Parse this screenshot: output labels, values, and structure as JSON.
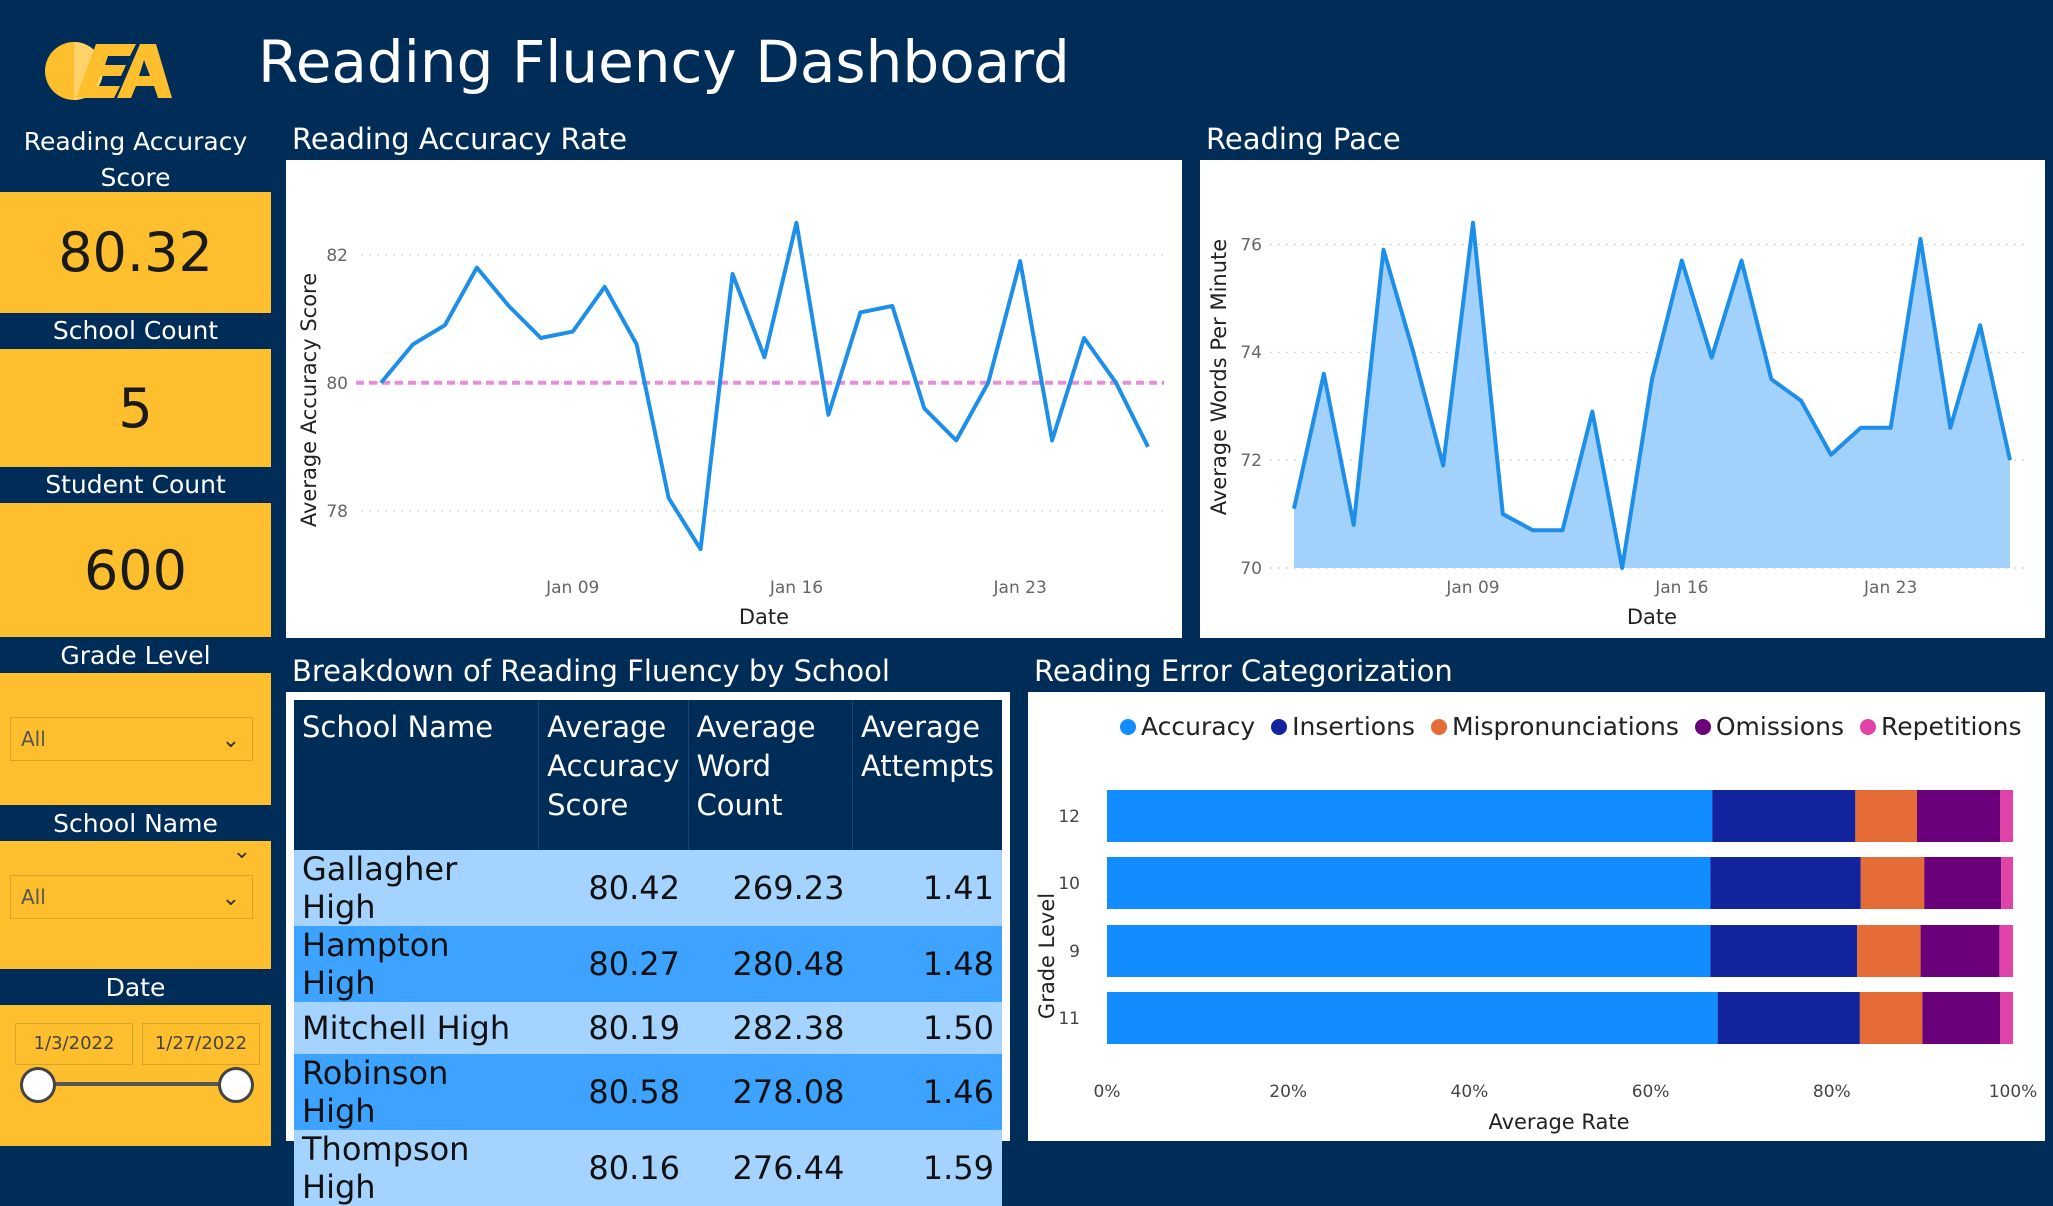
{
  "header": {
    "title": "Reading Fluency Dashboard",
    "logo_text": "OEA"
  },
  "sidebar": {
    "accuracy_label": "Reading Accuracy Score",
    "accuracy_value": "80.32",
    "school_count_label": "School Count",
    "school_count_value": "5",
    "student_count_label": "Student Count",
    "student_count_value": "600",
    "grade_level_label": "Grade Level",
    "grade_level_value": "All",
    "school_name_label": "School Name",
    "school_name_value": "All",
    "date_label": "Date",
    "date_start": "1/3/2022",
    "date_end": "1/27/2022"
  },
  "accuracy_chart": {
    "title": "Reading Accuracy Rate",
    "xlabel": "Date",
    "ylabel": "Average Accuracy Score",
    "yticks": [
      "78",
      "80",
      "82"
    ],
    "xticks": [
      "Jan 09",
      "Jan 16",
      "Jan 23"
    ]
  },
  "pace_chart": {
    "title": "Reading Pace",
    "xlabel": "Date",
    "ylabel": "Average Words Per Minute",
    "yticks": [
      "70",
      "72",
      "74",
      "76"
    ],
    "xticks": [
      "Jan 09",
      "Jan 16",
      "Jan 23"
    ]
  },
  "school_table": {
    "title": "Breakdown of Reading Fluency by School",
    "headers": [
      "School Name",
      "Average Accuracy Score",
      "Average Word Count",
      "Average Attempts"
    ],
    "rows": [
      [
        "Gallagher High",
        "80.42",
        "269.23",
        "1.41"
      ],
      [
        "Hampton High",
        "80.27",
        "280.48",
        "1.48"
      ],
      [
        "Mitchell High",
        "80.19",
        "282.38",
        "1.50"
      ],
      [
        "Robinson High",
        "80.58",
        "278.08",
        "1.46"
      ],
      [
        "Thompson High",
        "80.16",
        "276.44",
        "1.59"
      ]
    ]
  },
  "error_chart": {
    "title": "Reading Error Categorization",
    "xlabel": "Average Rate",
    "ylabel": "Grade Level",
    "xticks": [
      "0%",
      "20%",
      "40%",
      "60%",
      "80%",
      "100%"
    ]
  },
  "colors": {
    "navy": "#002d58",
    "gold": "#fdbf2d",
    "line_blue": "#1e8fe8",
    "area_blue": "#a2d1fb",
    "target_pink": "#e88ed6"
  },
  "chart_data": [
    {
      "type": "line",
      "title": "Reading Accuracy Rate",
      "xlabel": "Date",
      "ylabel": "Average Accuracy Score",
      "x": [
        "2022-01-03",
        "2022-01-04",
        "2022-01-05",
        "2022-01-06",
        "2022-01-07",
        "2022-01-08",
        "2022-01-09",
        "2022-01-10",
        "2022-01-11",
        "2022-01-12",
        "2022-01-13",
        "2022-01-14",
        "2022-01-15",
        "2022-01-16",
        "2022-01-17",
        "2022-01-18",
        "2022-01-19",
        "2022-01-20",
        "2022-01-21",
        "2022-01-22",
        "2022-01-23",
        "2022-01-24",
        "2022-01-25",
        "2022-01-26",
        "2022-01-27"
      ],
      "series": [
        {
          "values": [
            80.0,
            80.6,
            80.9,
            81.8,
            81.2,
            80.7,
            80.8,
            81.5,
            80.6,
            78.2,
            77.4,
            81.7,
            80.4,
            82.5,
            79.5,
            81.1,
            81.2,
            79.6,
            79.1,
            80.0,
            81.9,
            79.1,
            80.7,
            80.0,
            79.0
          ]
        }
      ],
      "reference_line": 80.0,
      "ylim": [
        77.2,
        82.7
      ],
      "grid": true
    },
    {
      "type": "area",
      "title": "Reading Pace",
      "xlabel": "Date",
      "ylabel": "Average Words Per Minute",
      "x": [
        "2022-01-03",
        "2022-01-04",
        "2022-01-05",
        "2022-01-06",
        "2022-01-07",
        "2022-01-08",
        "2022-01-09",
        "2022-01-10",
        "2022-01-11",
        "2022-01-12",
        "2022-01-13",
        "2022-01-14",
        "2022-01-15",
        "2022-01-16",
        "2022-01-17",
        "2022-01-18",
        "2022-01-19",
        "2022-01-20",
        "2022-01-21",
        "2022-01-22",
        "2022-01-23",
        "2022-01-24",
        "2022-01-25",
        "2022-01-26",
        "2022-01-27"
      ],
      "series": [
        {
          "values": [
            71.1,
            73.6,
            70.8,
            75.9,
            74.0,
            71.9,
            76.4,
            71.0,
            70.7,
            70.7,
            72.9,
            70.0,
            73.5,
            75.7,
            73.9,
            75.7,
            73.5,
            73.1,
            72.1,
            72.6,
            72.6,
            76.1,
            72.6,
            74.5,
            72.0
          ]
        }
      ],
      "ylim": [
        70,
        76.6
      ],
      "grid": true
    },
    {
      "type": "bar",
      "orientation": "horizontal",
      "stacked": true,
      "title": "Reading Error Categorization",
      "xlabel": "Average Rate",
      "ylabel": "Grade Level",
      "categories": [
        "12",
        "10",
        "9",
        "11"
      ],
      "series": [
        {
          "name": "Accuracy",
          "color": "#118dff",
          "values": [
            0.668,
            0.666,
            0.666,
            0.674
          ]
        },
        {
          "name": "Insertions",
          "color": "#12239e",
          "values": [
            0.158,
            0.166,
            0.162,
            0.157
          ]
        },
        {
          "name": "Mispronunciations",
          "color": "#e66c37",
          "values": [
            0.068,
            0.07,
            0.07,
            0.069
          ]
        },
        {
          "name": "Omissions",
          "color": "#6b007b",
          "values": [
            0.092,
            0.085,
            0.087,
            0.086
          ]
        },
        {
          "name": "Repetitions",
          "color": "#e044a7",
          "values": [
            0.014,
            0.013,
            0.015,
            0.014
          ]
        }
      ],
      "xlim": [
        0,
        1
      ],
      "legend": "top"
    }
  ]
}
